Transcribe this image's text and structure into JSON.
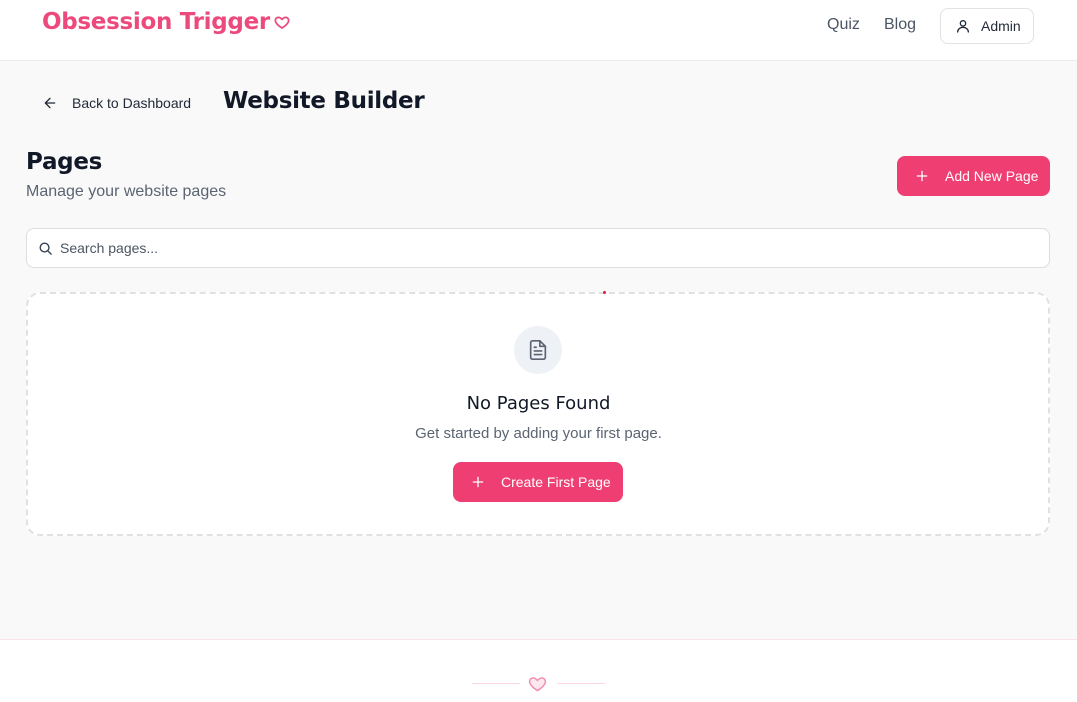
{
  "header": {
    "brand": "Obsession Trigger",
    "nav": [
      {
        "label": "Quiz"
      },
      {
        "label": "Blog"
      }
    ],
    "account_label": "Admin"
  },
  "toolbar": {
    "back_label": "Back to Dashboard",
    "title": "Website Builder"
  },
  "pages_section": {
    "title": "Pages",
    "subtitle": "Manage your website pages",
    "add_button_label": "Add New Page"
  },
  "search": {
    "placeholder": "Search pages...",
    "value": ""
  },
  "empty_state": {
    "title": "No Pages Found",
    "message": "Get started by adding your first page.",
    "button_label": "Create First Page"
  },
  "colors": {
    "brand": "#ec4a7c",
    "primary_button": "#ef3f72",
    "background": "#f9f9f9"
  },
  "icons": {
    "logo": "heart-icon",
    "account": "user-icon",
    "back": "arrow-left-icon",
    "add": "plus-icon",
    "search": "search-icon",
    "empty": "file-text-icon",
    "footer": "heart-icon"
  }
}
